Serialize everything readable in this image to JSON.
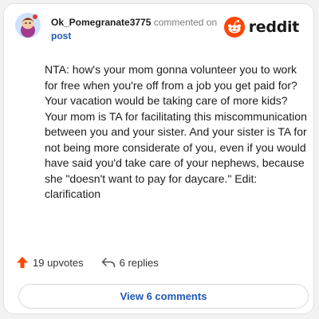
{
  "comment": {
    "username": "Ok_Pomegranate3775",
    "commented_on": "commented on",
    "post_link": "post",
    "brand": "reddit",
    "text": "NTA: how's your mom gonna volunteer you to work for free when you're off from a job you get paid for? Your vacation would be taking care of more kids? Your mom is TA for facilitating this miscommunication between you and your sister. And your sister is TA for not being more considerate of you, even if you would have said you'd take care of your nephews, because she \"doesn't want to pay for daycare.\" Edit: clarification"
  },
  "actions": {
    "upvotes_label": "19 upvotes",
    "replies_label": "6 replies",
    "view_comments_label": "View 6 comments"
  },
  "icons": {
    "avatar": "avatar-icon",
    "logo": "reddit-logo-icon",
    "upvote": "upvote-arrow-icon",
    "reply": "reply-arrow-icon"
  },
  "colors": {
    "reddit_orange": "#ff4500",
    "link_blue": "#1f57b5",
    "text": "#1c1c1c",
    "muted": "#7c7c7c"
  }
}
